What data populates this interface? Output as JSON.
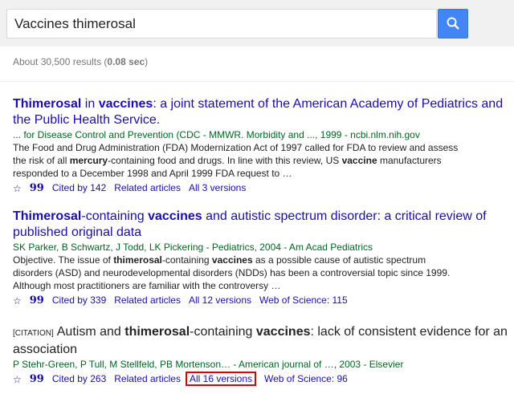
{
  "search": {
    "query": "Vaccines thimerosal"
  },
  "stats": {
    "prefix": "About 30,500 results (",
    "time": "0.08 sec",
    "suffix": ")"
  },
  "results": [
    {
      "title_parts": [
        "Thimerosal",
        " in ",
        "vaccines",
        ": a joint statement of the American Academy of Pediatrics and the Public Health Service."
      ],
      "authors": "... for Disease Control and Prevention (CDC - MMWR. Morbidity and ..., 1999 - ncbi.nlm.nih.gov",
      "snippet_parts": [
        "The Food and Drug Administration (FDA) Modernization Act of 1997 called for FDA to review and assess the risk of all ",
        "mercury",
        "-containing food and drugs. In line with this review, US ",
        "vaccine",
        " manufacturers responded to a December 1998 and April 1999 FDA request to …"
      ],
      "cited_by": "Cited by 142",
      "related": "Related articles",
      "versions": "All 3 versions"
    },
    {
      "title_parts": [
        "Thimerosal",
        "-containing ",
        "vaccines",
        " and autistic spectrum disorder: a critical review of published original data"
      ],
      "authors": "SK Parker, B Schwartz, J Todd, LK Pickering - Pediatrics, 2004 - Am Acad Pediatrics",
      "snippet_parts": [
        "Objective. The issue of ",
        "thimerosal",
        "-containing ",
        "vaccines",
        " as a possible cause of autistic spectrum disorders (ASD) and neurodevelopmental disorders (NDDs) has been a controversial topic since 1999. Although most practitioners are familiar with the controversy …"
      ],
      "cited_by": "Cited by 339",
      "related": "Related articles",
      "versions": "All 12 versions",
      "wos": "Web of Science: 115"
    },
    {
      "tag": "[CITATION]",
      "title_parts": [
        "Autism and ",
        "thimerosal",
        "-containing ",
        "vaccines",
        ": lack of consistent evidence for an association"
      ],
      "authors": "P Stehr-Green, P Tull, M Stellfeld, PB Mortenson… - American journal of …, 2003 - Elsevier",
      "cited_by": "Cited by 263",
      "related": "Related articles",
      "versions": "All 16 versions",
      "wos": "Web of Science: 96"
    }
  ],
  "icons": {
    "star": "star-icon",
    "cite": "cite-icon",
    "search": "magnifier-icon"
  },
  "colors": {
    "link": "#1a0dab",
    "authors": "#006621",
    "highlight_box": "#dd0000",
    "search_button": "#4285f4"
  }
}
